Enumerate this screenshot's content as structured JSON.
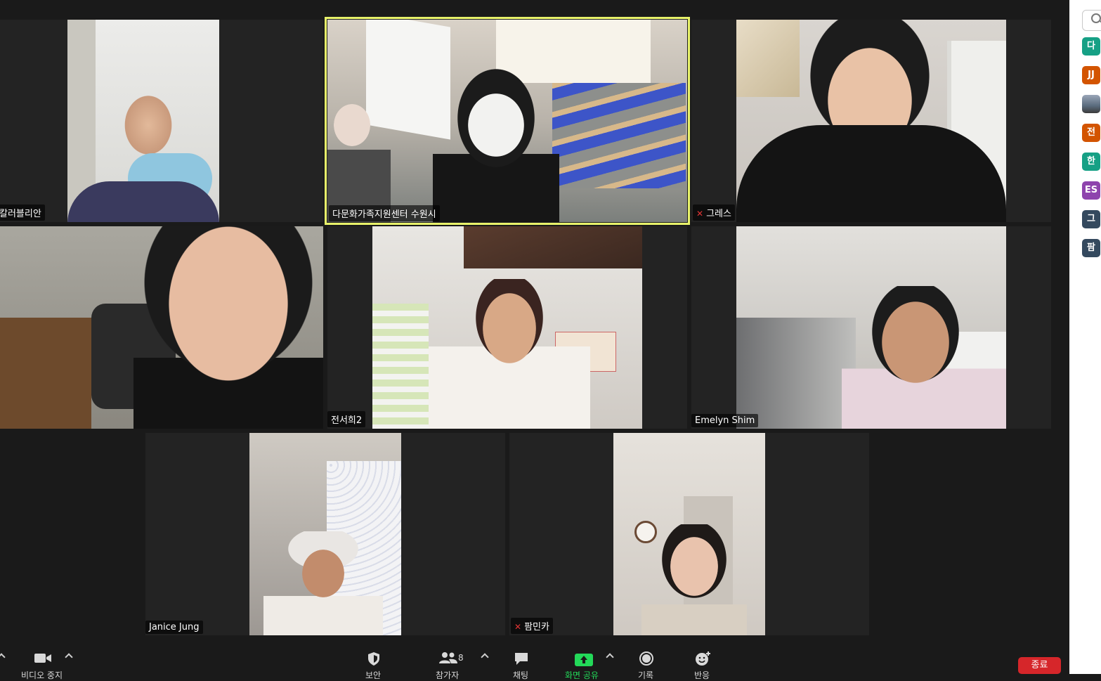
{
  "participants": [
    {
      "name": "칼러블리안",
      "muted": false,
      "active": false
    },
    {
      "name": "다문화가족지원센터 수원시",
      "muted": false,
      "active": true
    },
    {
      "name": "그레스",
      "muted": true,
      "active": false
    },
    {
      "name": "",
      "muted": false,
      "active": false
    },
    {
      "name": "전서희2",
      "muted": false,
      "active": false
    },
    {
      "name": "Emelyn Shim",
      "muted": false,
      "active": false
    },
    {
      "name": "Janice Jung",
      "muted": false,
      "active": false
    },
    {
      "name": "팜민카",
      "muted": true,
      "active": false
    }
  ],
  "sidebar": {
    "avatars": [
      {
        "initials": "다",
        "color": "#16a085"
      },
      {
        "initials": "JJ",
        "color": "#d35400"
      },
      {
        "initials": "",
        "color": "#5a6b7d"
      },
      {
        "initials": "전",
        "color": "#d35400"
      },
      {
        "initials": "한",
        "color": "#16a085"
      },
      {
        "initials": "ES",
        "color": "#8e44ad"
      },
      {
        "initials": "그",
        "color": "#34495e"
      },
      {
        "initials": "팜",
        "color": "#34495e"
      }
    ]
  },
  "toolbar": {
    "video_label": "비디오 중지",
    "security_label": "보안",
    "participants_label": "참가자",
    "participants_count": "8",
    "chat_label": "채팅",
    "share_label": "화면 공유",
    "record_label": "기록",
    "reactions_label": "반응",
    "end_label": "종료"
  },
  "colors": {
    "active_speaker": "#e8f26a",
    "share_green": "#23d959",
    "end_red": "#d6262a",
    "muted_red": "#e03434"
  }
}
